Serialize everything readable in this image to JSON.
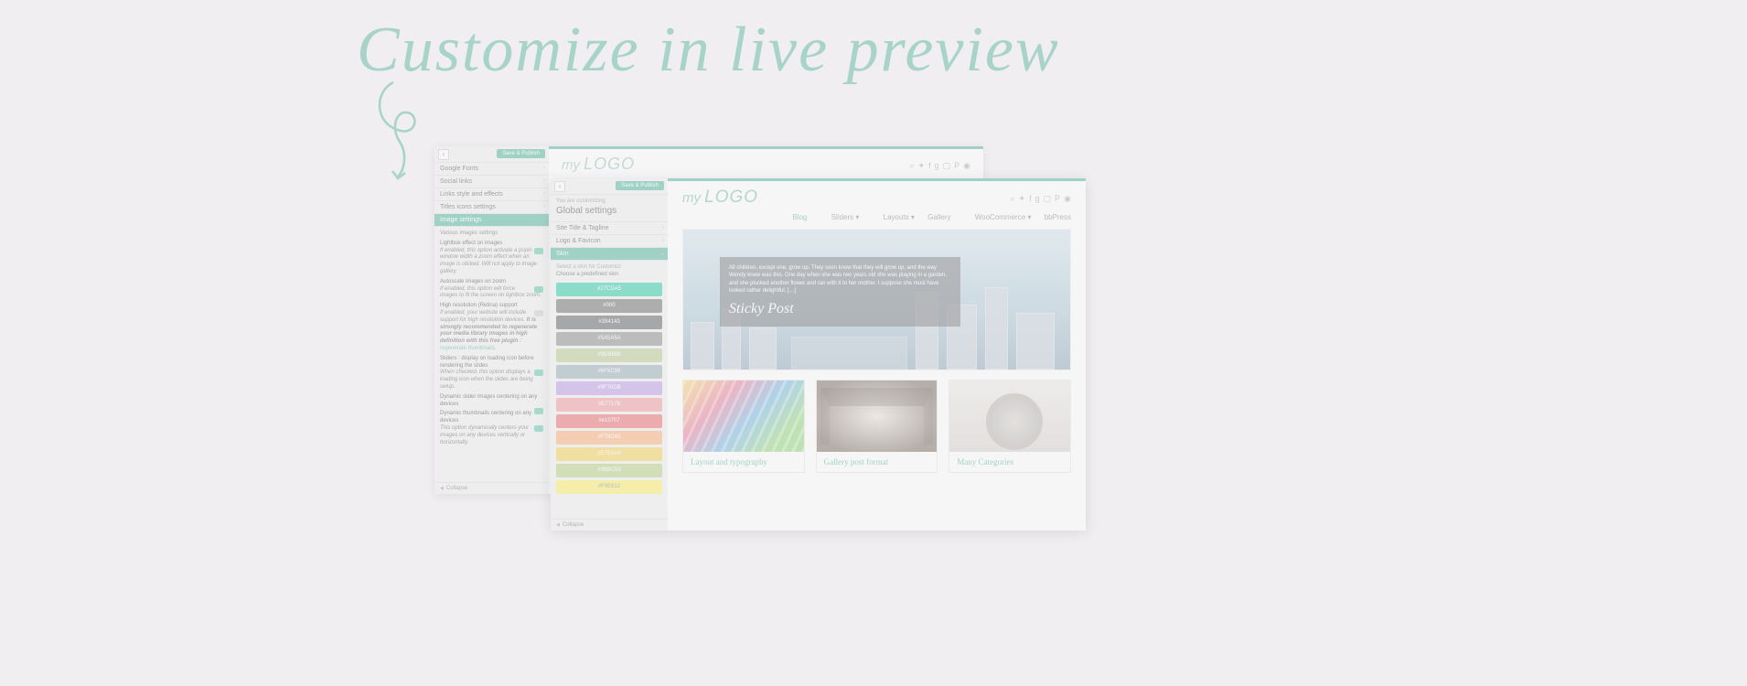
{
  "headline": "Customize in live preview",
  "panel1": {
    "save": "Save & Publish",
    "rows": [
      {
        "label": "Google Fonts"
      },
      {
        "label": "Social links"
      },
      {
        "label": "Links style and effects"
      },
      {
        "label": "Titles icons settings"
      },
      {
        "label": "Image settings",
        "active": true
      }
    ],
    "various": "Various images settings",
    "opt1": {
      "h": "Lightbox effect on images",
      "d": "If enabled, this option activate a popin window width a zoom effect when an image is clicked. Will not apply to image gallery."
    },
    "opt2": {
      "h": "Autoscale images on zoom",
      "d": "If enabled, this option will force images to fit the screen on lightbox zoom."
    },
    "opt3": {
      "h": "High resolution (Retina) support",
      "d": "If enabled, your website will include support for high resolution devices.",
      "d2": "It is strongly recommended to regenerate your media library images in high definition with this free plugin :",
      "link": "regenerate thumbnails"
    },
    "opt4": {
      "h": "Sliders : display on loading icon before rendering the slides",
      "d": "When checked, this option displays a loading icon when the slides are being setup."
    },
    "opt5": {
      "h": "Dynamic slider images centering on any devices"
    },
    "opt6": {
      "h": "Dynamic thumbnails centering on any devices",
      "d": "This option dynamically centers your images on any devices vertically or horizontally"
    },
    "collapse": "Collapse",
    "logo": {
      "small": "my",
      "big": "LOGO"
    }
  },
  "panel2": {
    "save": "Save & Publish",
    "crumb": "You are customizing",
    "section": "Global settings",
    "rows": [
      {
        "label": "Site Title & Tagline"
      },
      {
        "label": "Logo & Favicon"
      },
      {
        "label": "Skin",
        "active": true
      }
    ],
    "hint": "Select a skin for Customizr",
    "hint2": "Choose a predefined skin",
    "swatches": [
      {
        "hex": "#27CDA5",
        "bg": "#27CDA5",
        "fg": "#ffffff"
      },
      {
        "hex": "#000",
        "bg": "#6d6d6d",
        "fg": "#ffffff"
      },
      {
        "hex": "#394143",
        "bg": "#5a6163",
        "fg": "#ffffff"
      },
      {
        "hex": "#5A5A5A",
        "bg": "#8a8a8a",
        "fg": "#ffffff"
      },
      {
        "hex": "#9DB668",
        "bg": "#b6c98e",
        "fg": "#ffffff"
      },
      {
        "hex": "#6F8C98",
        "bg": "#94acb5",
        "fg": "#ffffff"
      },
      {
        "hex": "#9F76DB",
        "bg": "#b89ae5",
        "fg": "#ffffff"
      },
      {
        "hex": "#E77176",
        "bg": "#ee979b",
        "fg": "#ffffff"
      },
      {
        "hex": "#e10707",
        "bg": "#e86a6a",
        "fg": "#ffffff"
      },
      {
        "hex": "#F78C40",
        "bg": "#f9ac76",
        "fg": "#ffffff"
      },
      {
        "hex": "#E7BA04",
        "bg": "#eed052",
        "fg": "#ffffff"
      },
      {
        "hex": "#9BBC53",
        "bg": "#b5cf80",
        "fg": "#ffffff"
      },
      {
        "hex": "#F9E612",
        "bg": "#fbef67",
        "fg": "#888888"
      }
    ],
    "collapse": "Collapse"
  },
  "preview": {
    "logo": {
      "small": "my",
      "big": "LOGO"
    },
    "nav": [
      "Blog",
      "Sliders",
      "Layouts",
      "Gallery",
      "WooCommerce",
      "bbPress"
    ],
    "hero_text": "All children, except one, grow up. They soon know that they will grow up, and the way Wendy knew was this. One day when she was two years old she was playing in a garden, and she plucked another flower and ran with it to her mother. I suppose she must have looked rather delightful, […]",
    "hero_title": "Sticky Post",
    "cards": [
      {
        "title": "Layout and typography"
      },
      {
        "title": "Gallery post format"
      },
      {
        "title": "Many Categories"
      }
    ]
  }
}
